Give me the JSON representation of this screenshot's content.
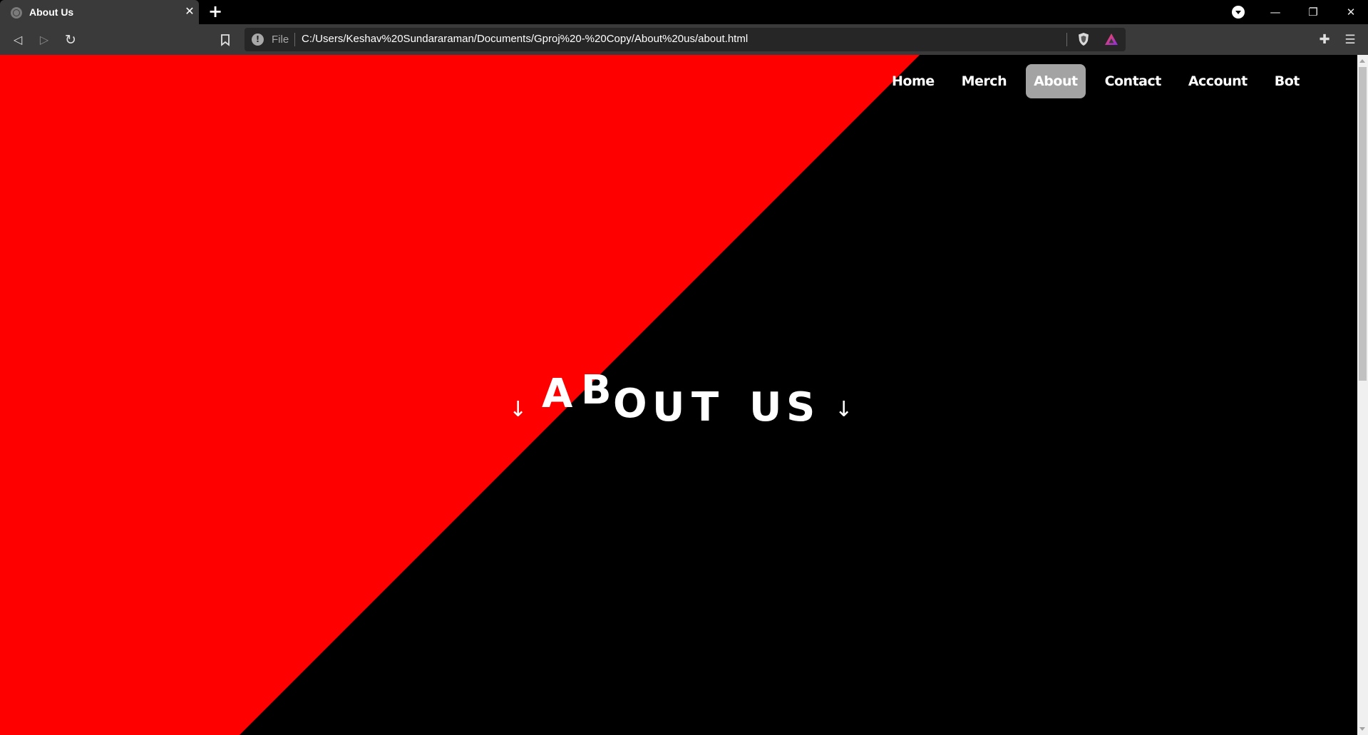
{
  "browser": {
    "tab": {
      "title": "About Us",
      "close_glyph": "✕"
    },
    "new_tab_glyph": "+",
    "window_controls": {
      "minimize": "—",
      "restore": "❐",
      "close": "✕"
    },
    "toolbar": {
      "back_glyph": "◁",
      "forward_glyph": "▷",
      "reload_glyph": "↻",
      "bookmark_glyph": "🔖",
      "omnibox": {
        "info_glyph": "!",
        "scheme_label": "File",
        "url": "C:/Users/Keshav%20Sundararaman/Documents/Gproj%20-%20Copy/About%20us/about.html"
      },
      "extensions_glyph": "✚",
      "menu_glyph": "☰"
    }
  },
  "page": {
    "colors": {
      "red": "#ff0000",
      "black": "#000000",
      "active_nav_bg": "#a3a3a3"
    },
    "nav": {
      "items": [
        {
          "label": "Home",
          "active": false
        },
        {
          "label": "Merch",
          "active": false
        },
        {
          "label": "About",
          "active": true
        },
        {
          "label": "Contact",
          "active": false
        },
        {
          "label": "Account",
          "active": false
        },
        {
          "label": "Bot",
          "active": false
        }
      ]
    },
    "hero": {
      "left_arrow": "↓",
      "right_arrow": "↓",
      "letters": [
        "A",
        "B",
        "O",
        "U",
        "T",
        "U",
        "S"
      ]
    }
  }
}
